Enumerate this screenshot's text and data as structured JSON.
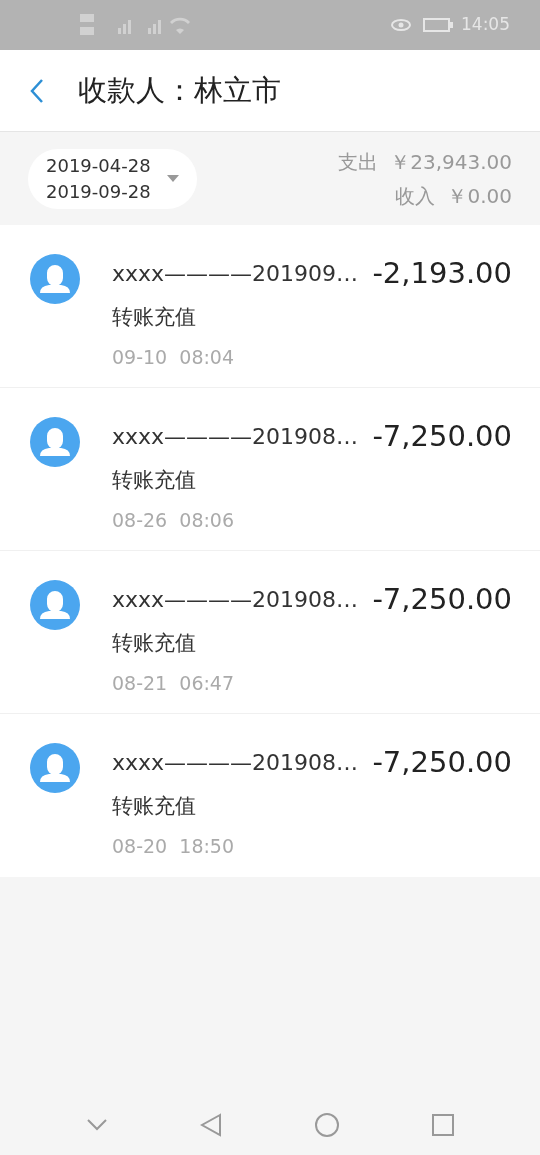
{
  "status_bar": {
    "time": "14:05"
  },
  "header": {
    "title": "收款人：林立市"
  },
  "filter": {
    "start_date": "2019-04-28",
    "end_date": "2019-09-28"
  },
  "summary": [
    {
      "label": "支出",
      "amount": "￥23,943.00"
    },
    {
      "label": "收入",
      "amount": "￥0.00"
    }
  ],
  "transactions": [
    {
      "name": "xxxx————201909…",
      "amount": "-2,193.00",
      "type": "转账充值",
      "time": "09-10  08:04"
    },
    {
      "name": "xxxx————201908…",
      "amount": "-7,250.00",
      "type": "转账充值",
      "time": "08-26  08:06"
    },
    {
      "name": "xxxx————201908…",
      "amount": "-7,250.00",
      "type": "转账充值",
      "time": "08-21  06:47"
    },
    {
      "name": "xxxx————201908…",
      "amount": "-7,250.00",
      "type": "转账充值",
      "time": "08-20  18:50"
    }
  ]
}
